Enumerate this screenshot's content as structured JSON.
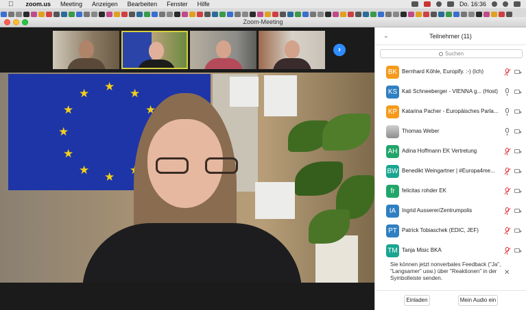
{
  "menubar": {
    "app": "zoom.us",
    "menus": [
      "Meeting",
      "Anzeigen",
      "Bearbeiten",
      "Fenster",
      "Hilfe"
    ],
    "clock": "Do. 16:36"
  },
  "window": {
    "title": "Zoom-Meeting"
  },
  "panel": {
    "title": "Teilnehmer (11)",
    "search_placeholder": "Suchen",
    "participants": [
      {
        "initials": "BK",
        "color": "#f59a1b",
        "name": "Bernhard Köhle, Europify. :-) (Ich)",
        "muted": true
      },
      {
        "initials": "KS",
        "color": "#2f7fc1",
        "name": "Kati Schneeberger - VIENNA g...  (Host)",
        "muted": false
      },
      {
        "initials": "KP",
        "color": "#f59a1b",
        "name": "Katarina Pacher - Europäisches Parla...",
        "muted": false
      },
      {
        "initials": "",
        "color": "photo",
        "name": "Thomas Weber",
        "muted": false
      },
      {
        "initials": "AH",
        "color": "#22a56a",
        "name": "Adina Hoffmann EK Vertretung",
        "muted": true
      },
      {
        "initials": "BW",
        "color": "#1aa591",
        "name": "Benedikt Weingartner | #Europa4me...",
        "muted": true
      },
      {
        "initials": "fr",
        "color": "#22a56a",
        "name": "felicitas rohder EK",
        "muted": true
      },
      {
        "initials": "IA",
        "color": "#2f7fc1",
        "name": "Ingrid Ausserer/Zentrumpolis",
        "muted": true
      },
      {
        "initials": "PT",
        "color": "#2f7fc1",
        "name": "Patrick Tobiaschek (EDIC, JEF)",
        "muted": true
      },
      {
        "initials": "TM",
        "color": "#1aa591",
        "name": "Tanja Misic BKA",
        "muted": true
      }
    ],
    "notice": "Sie können jetzt nonverbales Feedback (\"Ja\", \"Langsamer\" usw.) über \"Reaktionen\" in der Symbolleiste senden.",
    "invite_label": "Einladen",
    "unmute_label": "Mein Audio ein"
  }
}
